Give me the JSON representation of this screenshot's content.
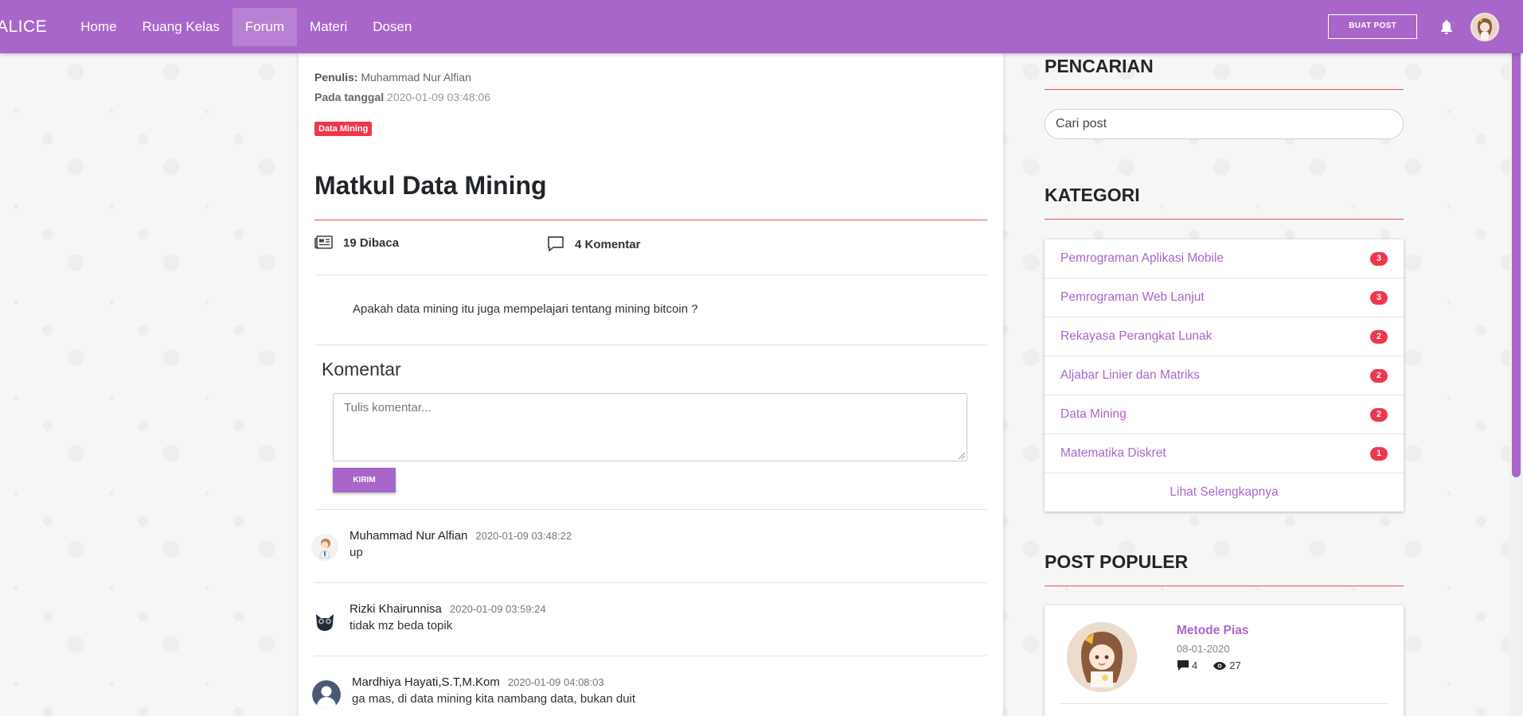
{
  "nav": {
    "brand": "ALICE",
    "items": [
      "Home",
      "Ruang Kelas",
      "Forum",
      "Materi",
      "Dosen"
    ],
    "active": "Forum",
    "create_post": "BUAT POST"
  },
  "post": {
    "author_label": "Penulis:",
    "author": "Muhammad Nur Alfian",
    "date_label": "Pada tanggal",
    "date": "2020-01-09 03:48:06",
    "category_badge": "Data Mining",
    "title": "Matkul Data Mining",
    "views": "19 Dibaca",
    "comments_count": "4 Komentar",
    "body": "Apakah data mining itu juga mempelajari tentang mining bitcoin ?"
  },
  "comment_form": {
    "heading": "Komentar",
    "placeholder": "Tulis komentar...",
    "submit": "KIRIM"
  },
  "comments": [
    {
      "name": "Muhammad Nur Alfian",
      "date": "2020-01-09 03:48:22",
      "text": "up"
    },
    {
      "name": "Rizki Khairunnisa",
      "date": "2020-01-09 03:59:24",
      "text": "tidak mz beda topik"
    },
    {
      "name": "Mardhiya Hayati,S.T,M.Kom",
      "date": "2020-01-09 04:08:03",
      "text": "ga mas, di data mining kita nambang data, bukan duit"
    }
  ],
  "sidebar": {
    "search_heading": "PENCARIAN",
    "search_placeholder": "Cari post",
    "category_heading": "KATEGORI",
    "categories": [
      {
        "name": "Pemrograman Aplikasi Mobile",
        "count": "3"
      },
      {
        "name": "Pemrograman Web Lanjut",
        "count": "3"
      },
      {
        "name": "Rekayasa Perangkat Lunak",
        "count": "2"
      },
      {
        "name": "Aljabar Linier dan Matriks",
        "count": "2"
      },
      {
        "name": "Data Mining",
        "count": "2"
      },
      {
        "name": "Matematika Diskret",
        "count": "1"
      }
    ],
    "see_more": "Lihat Selengkapnya",
    "popular_heading": "POST POPULER",
    "popular": [
      {
        "title": "Metode Pias",
        "date": "08-01-2020",
        "comments": "4",
        "views": "27"
      }
    ]
  },
  "colors": {
    "primary": "#a966ca",
    "danger": "#f0364d",
    "rule": "#e84a4a"
  }
}
